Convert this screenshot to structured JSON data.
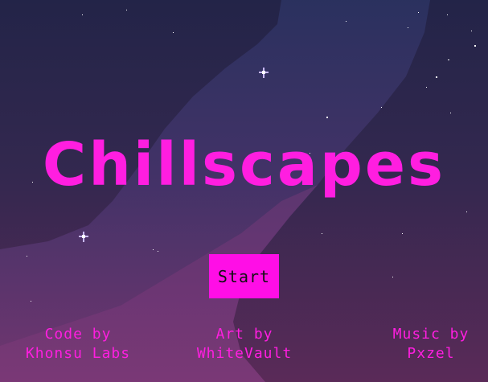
{
  "game": {
    "title": "Chillscapes",
    "start_label": "Start",
    "credits": {
      "code_heading": "Code by",
      "code_name": "Khonsu Labs",
      "art_heading": "Art by",
      "art_name": "WhiteVault",
      "music_heading": "Music by",
      "music_name": "Pxzel"
    }
  },
  "colors": {
    "accent": "#ff1ee0",
    "button": "#ff0ee6",
    "sky_top": "#1f2247",
    "sky_bottom": "#5a2a58"
  }
}
